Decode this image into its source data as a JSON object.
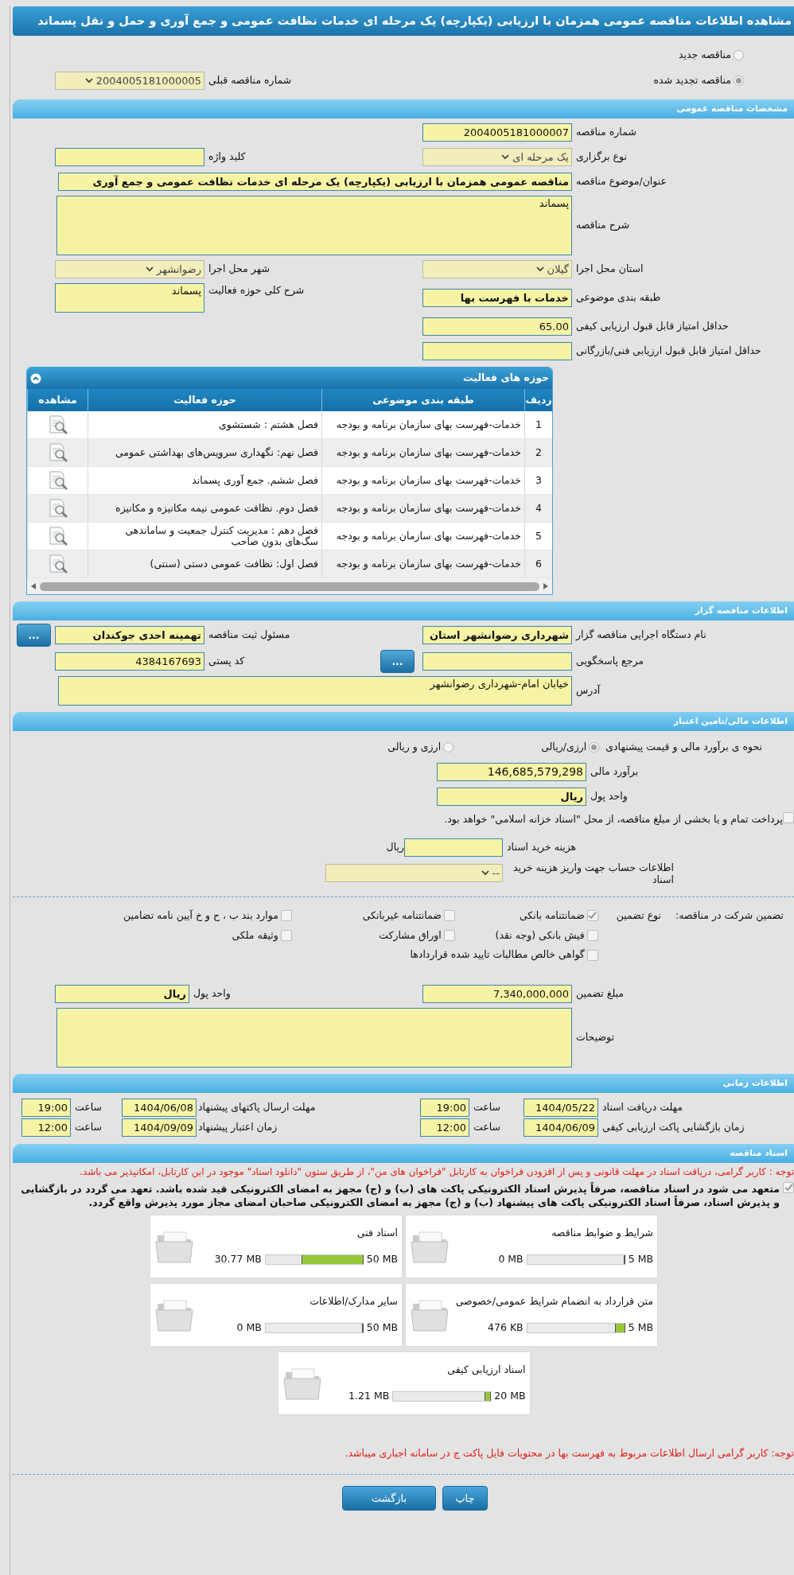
{
  "title": "مشاهده اطلاعات مناقصه عمومی همزمان با ارزیابی (یکپارچه) یک مرحله ای خدمات نظافت عمومی و جمع آوری و حمل و نقل پسماند",
  "tender_kind": [
    {
      "label": "مناقصه جدید",
      "selected": false
    },
    {
      "label": "مناقصه تجدید شده",
      "selected": true
    }
  ],
  "previous_tender": {
    "label": "شماره مناقصه قبلی",
    "value": "2004005181000005"
  },
  "general": {
    "header": "مشخصات مناقصه عمومی",
    "rows": [
      {
        "items": [
          {
            "label": "شماره مناقصه",
            "value": "2004005181000007",
            "kind": "input"
          }
        ]
      },
      {
        "items": [
          {
            "label": "نوع برگزاری",
            "value": "یک مرحله ای",
            "kind": "select"
          },
          {
            "label": "کلید واژه",
            "kind": "input"
          }
        ]
      },
      {
        "items": [
          {
            "label": "عنوان/موضوع مناقصه",
            "value": "مناقصه عمومی همزمان با ارزیابی (یکپارچه) یک مرحله ای  خدمات نظافت عمومی و جمع آوری",
            "kind": "wide-input",
            "bold": true
          }
        ]
      },
      {
        "items": [
          {
            "label": "شرح مناقصه",
            "value": "پسماند",
            "kind": "large-textarea"
          }
        ]
      },
      {
        "items": [
          {
            "label": "استان محل اجرا",
            "value": "گیلان",
            "kind": "select"
          },
          {
            "label": "شهر محل اجرا",
            "value": "رضوانشهر",
            "kind": "select"
          }
        ]
      },
      {
        "items": [
          {
            "label": "طبقه بندی موضوعی",
            "value": "خدمات با فهرست بها",
            "kind": "input",
            "bold": true
          },
          {
            "label": "شرح کلی حوزه فعالیت",
            "value": "پسماند",
            "kind": "textarea"
          }
        ]
      },
      {
        "items": [
          {
            "label": "حداقل امتیاز قابل قبول ارزیابی کیفی",
            "value": "65.00",
            "kind": "input"
          }
        ]
      },
      {
        "items": [
          {
            "label": "حداقل امتیاز قابل قبول ارزیابی فنی/بازرگانی",
            "kind": "input"
          }
        ]
      }
    ]
  },
  "activities": {
    "header": "حوزه های فعالیت",
    "columns": [
      "ردیف",
      "طبقه بندی موضوعی",
      "حوزه فعالیت",
      "مشاهده"
    ],
    "rows": [
      {
        "index": "1",
        "category": "خدمات-فهرست بهای سازمان برنامه و بودجه",
        "activity": "فصل هشتم : شستشوی"
      },
      {
        "index": "2",
        "category": "خدمات-فهرست بهای سازمان برنامه و بودجه",
        "activity": "فصل نهم: نگهداری سرویس‌های بهداشتی عمومی"
      },
      {
        "index": "3",
        "category": "خدمات-فهرست بهای سازمان برنامه و بودجه",
        "activity": "فصل ششم. جمع آوری پسماند"
      },
      {
        "index": "4",
        "category": "خدمات-فهرست بهای سازمان برنامه و بودجه",
        "activity": "فصل دوم. نظافت عمومی نیمه مکانیزه و مکانیزه"
      },
      {
        "index": "5",
        "category": "خدمات-فهرست بهای سازمان برنامه و بودجه",
        "activity": "فصل دهم : مدیریت کنترل جمعیت و ساماندهی سگ‌های بدون صاحب"
      },
      {
        "index": "6",
        "category": "خدمات-فهرست بهای سازمان برنامه و بودجه",
        "activity": "فصل اول: نظافت عمومی دستی (سنتی)"
      }
    ]
  },
  "organizer": {
    "header": "اطلاعات مناقصه گزار",
    "rows": [
      {
        "items": [
          {
            "label": "نام دستگاه اجرایی مناقصه گزار",
            "value": "شهرداری رضوانشهر استان",
            "kind": "input",
            "bold": true
          },
          {
            "label": "مسئول ثبت مناقصه",
            "value": "تهمینه احدی جوکندان",
            "kind": "input",
            "bold": true,
            "button": "..."
          }
        ]
      },
      {
        "items": [
          {
            "label": "مرجع پاسخگویی",
            "kind": "input",
            "button": "..."
          },
          {
            "label": "کد پستی",
            "value": "4384167693",
            "kind": "input"
          }
        ]
      },
      {
        "items": [
          {
            "label": "آدرس",
            "value": "خیابان امام-شهرداری رضوانشهر",
            "kind": "wide-textarea"
          }
        ]
      }
    ]
  },
  "financial": {
    "header": "اطلاعات مالی/تامین اعتبار",
    "estimate_method": {
      "label": "نحوه ی برآورد مالی و قیمت پیشنهادی",
      "options": [
        {
          "label": "ارزی/ریالی",
          "selected": true
        },
        {
          "label": "ارزی و ریالی",
          "selected": false
        }
      ]
    },
    "estimate": {
      "label": "برآورد مالی",
      "value": "146,685,579,298"
    },
    "currency": {
      "label": "واحد پول",
      "value": "ریال",
      "bold": true
    },
    "treasury": {
      "label": "پرداخت تمام و یا بخشی از مبلغ مناقصه، از محل \"اسناد خزانه اسلامی\" خواهد بود.",
      "checked": false
    },
    "document_fee": {
      "label": "هزینه خرید اسناد",
      "unit": "ریال"
    },
    "account": {
      "label": "اطلاعات حساب جهت واریز هزینه خرید اسناد",
      "value": "--"
    }
  },
  "guarantee": {
    "label": "تضمین شرکت در مناقصه:",
    "type_label": "نوع تضمین",
    "options": [
      {
        "label": "ضمانتنامه بانکی",
        "checked": true
      },
      {
        "label": "ضمانتنامه غیربانکی",
        "checked": false
      },
      {
        "label": "موارد بند ب ، ح و خ آیین نامه تضامین",
        "checked": false
      },
      {
        "label": "فیش بانکی (وجه نقد)",
        "checked": false
      },
      {
        "label": "اوراق مشارکت",
        "checked": false
      },
      {
        "label": "وثیقه ملکی",
        "checked": false
      },
      {
        "label": "گواهی خالص مطالبات تایید شده قراردادها",
        "checked": false
      }
    ],
    "rows": [
      {
        "items": [
          {
            "label": "مبلغ تضمین",
            "value": "7,340,000,000",
            "kind": "input"
          },
          {
            "label": "واحد پول",
            "value": "ریال",
            "kind": "input",
            "bold": true
          }
        ]
      },
      {
        "items": [
          {
            "label": "توضیحات",
            "kind": "large-textarea"
          }
        ]
      }
    ]
  },
  "timing": {
    "header": "اطلاعات زمانی",
    "rows": [
      {
        "items": [
          {
            "label": "مهلت دریافت اسناد",
            "date": "1404/05/22",
            "time_label": "ساعت",
            "time": "19:00"
          },
          {
            "label": "مهلت ارسال پاکتهای پیشنهاد",
            "date": "1404/06/08",
            "time_label": "ساعت",
            "time": "19:00"
          }
        ]
      },
      {
        "items": [
          {
            "label": "زمان بازگشایی پاکت ارزیابی کیفی",
            "date": "1404/06/09",
            "time_label": "ساعت",
            "time": "12:00"
          },
          {
            "label": "زمان اعتبار پیشنهاد",
            "date": "1404/09/09",
            "time_label": "ساعت",
            "time": "12:00"
          }
        ]
      }
    ]
  },
  "documents": {
    "header": "اسناد مناقصه",
    "notice": "توجه : کاربر گرامی، دریافت اسناد در مهلت قانونی و پس از افزودن فراخوان به کارتابل \"فراخوان های من\"، از طریق ستون \"دانلود اسناد\" موجود در این کارتابل، امکانپذیر می باشد.",
    "commitment": {
      "text": "متعهد می شود در اسناد مناقصه، صرفاً پذیرش اسناد الکترونیکی پاکت های (ب) و (ج) مجهز به امضای الکترونیکی قید شده باشد. تعهد می گردد در بازگشایی و پذیرش اسناد، صرفاً اسناد الکترونیکی پاکت های پیشنهاد (ب) و (ج) مجهز به امضای الکترونیکی صاحبان امضای مجاز مورد پذیرش واقع گردد.",
      "checked": true
    },
    "files": [
      {
        "title": "شرایط و ضوابط مناقصه",
        "limit": "5 MB",
        "size": "0 MB",
        "level": 0
      },
      {
        "title": "اسناد فنی",
        "limit": "50 MB",
        "size": "30.77 MB",
        "level": 0.63
      },
      {
        "title": "متن قرارداد به انضمام شرایط عمومی/خصوصی",
        "limit": "5 MB",
        "size": "476 KB",
        "level": 0.1
      },
      {
        "title": "سایر مدارک/اطلاعات",
        "limit": "50 MB",
        "size": "0 MB",
        "level": 0
      },
      {
        "title": "اسناد ارزیابی کیفی",
        "limit": "20 MB",
        "size": "1.21 MB",
        "level": 0.06
      }
    ],
    "footer_notice": "توجه: کاربر گرامی ارسال اطلاعات مربوط به فهرست بها در محتویات فایل پاکت ج در سامانه اجباری میباشد."
  },
  "buttons": [
    {
      "label": "چاپ"
    },
    {
      "label": "بازگشت"
    }
  ]
}
